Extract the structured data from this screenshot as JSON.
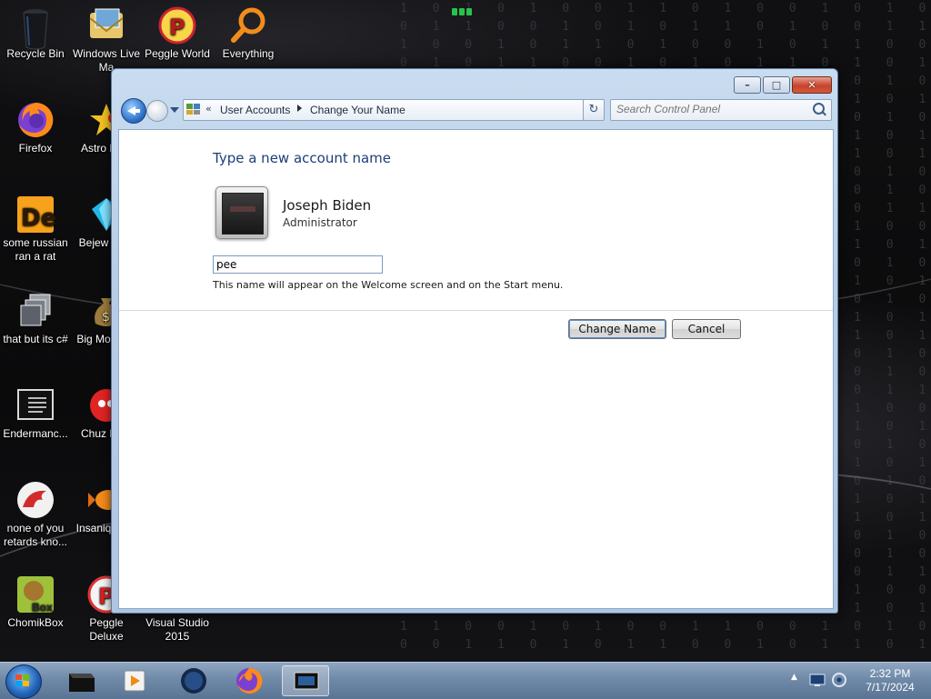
{
  "desktop": {
    "binary_rows": [
      "1 0 1 0 1 0 0 1 1 0 1 0 0 1 0 1 0 1 1 0",
      "0 1 1 0 0 1 0 1 0 1 1 0 1 0 0 1 1 0 0 1",
      "1 0 0 1 0 1 1 0 1 0 0 1 0 1 1 0 0 1 0 1",
      "0 1 0 1 1 0 0 1 0 1 0 1 1 0 1 0 1 0 1 0",
      "1 1 0 0 1 0 1 0 0 1 1 0 0 1 0 1 0 1 1 0",
      "0 0 1 1 0 1 0 1 1 0 0 1 0 1 1 0 1 0 0 1",
      "1 0 1 0 0 1 1 0 1 0 1 0 1 0 0 1 0 1 1 0",
      "0 1 0 1 1 0 1 0 0 1 0 1 0 1 1 0 1 0 0 1",
      "1 0 1 1 0 0 1 0 1 0 1 1 0 0 1 0 1 0 1 0",
      "0 1 0 0 1 1 0 1 0 1 0 0 1 1 0 1 0 1 0 1",
      "1 0 1 0 1 0 0 1 1 0 1 0 0 1 0 1 0 1 1 0",
      "0 1 1 0 0 1 0 1 0 1 1 0 1 0 0 1 1 0 0 1",
      "1 0 0 1 0 1 1 0 1 0 0 1 0 1 1 0 0 1 0 1",
      "0 1 0 1 1 0 0 1 0 1 0 1 1 0 1 0 1 0 1 0",
      "1 1 0 0 1 0 1 0 0 1 1 0 0 1 0 1 0 1 1 0",
      "0 0 1 1 0 1 0 1 1 0 0 1 0 1 1 0 1 0 0 1",
      "1 0 1 0 0 1 1 0 1 0 1 0 1 0 0 1 0 1 1 0",
      "0 1 0 1 1 0 1 0 0 1 0 1 0 1 1 0 1 0 0 1",
      "1 0 1 1 0 0 1 0 1 0 1 1 0 0 1 0 1 0 1 0",
      "0 1 0 0 1 1 0 1 0 1 0 0 1 1 0 1 0 1 0 1",
      "1 0 1 0 1 0 0 1 1 0 1 0 0 1 0 1 0 1 1 0",
      "0 1 1 0 0 1 0 1 0 1 1 0 1 0 0 1 1 0 0 1",
      "1 0 0 1 0 1 1 0 1 0 0 1 0 1 1 0 0 1 0 1",
      "0 1 0 1 1 0 0 1 0 1 0 1 1 0 1 0 1 0 1 0",
      "1 1 0 0 1 0 1 0 0 1 1 0 0 1 0 1 0 1 1 0",
      "0 0 1 1 0 1 0 1 1 0 0 1 0 1 1 0 1 0 0 1",
      "1 0 1 0 0 1 1 0 1 0 1 0 1 0 0 1 0 1 1 0",
      "0 1 0 1 1 0 1 0 0 1 0 1 0 1 1 0 1 0 0 1",
      "1 0 1 1 0 0 1 0 1 0 1 1 0 0 1 0 1 0 1 0",
      "0 1 0 0 1 1 0 1 0 1 0 0 1 1 0 1 0 1 0 1",
      "1 0 1 0 1 0 0 1 1 0 1 0 0 1 0 1 0 1 1 0",
      "0 1 1 0 0 1 0 1 0 1 1 0 1 0 0 1 1 0 0 1",
      "1 0 0 1 0 1 1 0 1 0 0 1 0 1 1 0 0 1 0 1",
      "0 1 0 1 1 0 0 1 0 1 0 1 1 0 1 0 1 0 1 0",
      "1 1 0 0 1 0 1 0 0 1 1 0 0 1 0 1 0 1 1 0",
      "0 0 1 1 0 1 0 1 1 0 0 1 0 1 1 0 1 0 0 1"
    ],
    "icons": {
      "recycle_bin": "Recycle Bin",
      "windows_live_mail": "Windows Live Ma",
      "peggle_world": "Peggle World",
      "everything": "Everything",
      "firefox": "Firefox",
      "astro": "Astro Delu",
      "some_russian": "some russian ran a rat",
      "bejeweled": "Bejew Delu",
      "that_but_csharp": "that but its c#",
      "big_money": "Big Mo Delu",
      "endermanch": "Endermanc...",
      "chuzzle": "Chuz Delu",
      "none_of_you": "none of you retards kno...",
      "insaniquarium": "Insaniq Delu",
      "chomikbox": "ChomikBox",
      "peggle_deluxe": "Peggle Deluxe",
      "visual_studio": "Visual Studio 2015"
    }
  },
  "window": {
    "caption": {
      "minimize": "–",
      "maximize": "□",
      "close": "✕"
    },
    "address": {
      "chevron": "«",
      "crumbs": [
        "User Accounts",
        "Change Your Name"
      ]
    },
    "refresh_glyph": "↻",
    "search_placeholder": "Search Control Panel",
    "content": {
      "heading": "Type a new account name",
      "account_name": "Joseph Biden",
      "account_role": "Administrator",
      "new_name_value": "pee",
      "hint": "This name will appear on the Welcome screen and on the Start menu.",
      "change_button": "Change Name",
      "cancel_button": "Cancel"
    }
  },
  "taskbar": {
    "clock_time": "2:32 PM",
    "clock_date": "7/17/2024",
    "tray_arrow": "▲"
  },
  "colors": {
    "heading_blue": "#1e3e78",
    "taskbar": "#6f89a8",
    "window_frame": "#b7cde6"
  }
}
